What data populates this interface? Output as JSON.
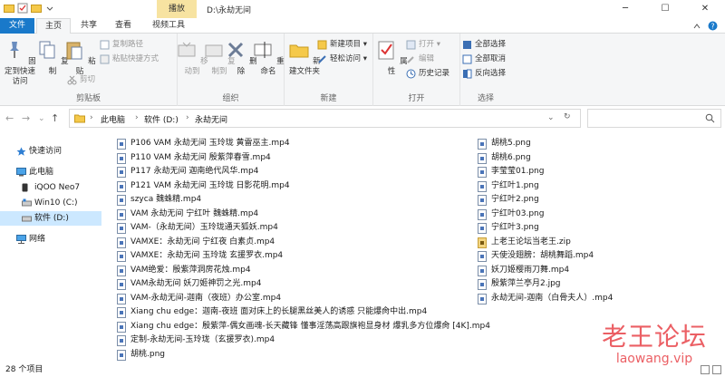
{
  "titlebar": {
    "context_tab": "播放",
    "path": "D:\\永劫无间",
    "minimize": "─",
    "maximize": "☐",
    "close": "✕"
  },
  "tabs": [
    "文件",
    "主页",
    "共享",
    "查看",
    "视频工具"
  ],
  "ribbon": {
    "clipboard": {
      "label": "剪贴板",
      "pin": "固定到快速访问",
      "copy": "复制",
      "paste": "粘贴",
      "cut": "剪切",
      "copy_path": "复制路径",
      "paste_shortcut": "粘贴快捷方式"
    },
    "organize": {
      "label": "组织",
      "move_to": "移动到",
      "copy_to": "复制到",
      "delete": "删除",
      "rename": "重命名"
    },
    "new": {
      "label": "新建",
      "new_folder": "新建文件夹",
      "new_item": "新建项目 ▾",
      "easy_access": "轻松访问 ▾"
    },
    "open": {
      "label": "打开",
      "properties": "属性",
      "open": "打开 ▾",
      "edit": "编辑",
      "history": "历史记录"
    },
    "select": {
      "label": "选择",
      "select_all": "全部选择",
      "select_none": "全部取消",
      "invert": "反向选择"
    }
  },
  "address": {
    "crumbs": [
      "此电脑",
      "软件 (D:)",
      "永劫无间"
    ],
    "search_placeholder": ""
  },
  "nav": [
    {
      "label": "快速访问",
      "icon": "star-icon"
    },
    {
      "label": "此电脑",
      "icon": "computer-icon"
    },
    {
      "label": "iQOO Neo7",
      "icon": "phone-icon"
    },
    {
      "label": "Win10 (C:)",
      "icon": "drive-icon"
    },
    {
      "label": "软件 (D:)",
      "icon": "drive-icon"
    },
    {
      "label": "网络",
      "icon": "network-icon"
    }
  ],
  "files_col1": [
    "P106 VAM 永劫无间 玉玲珑 黄雷巫主.mp4",
    "P110 VAM 永劫无间 殷紫萍春雪.mp4",
    "P117 永劫无间 迦南绝代风华.mp4",
    "P121 VAM 永劫无间 玉玲珑 日影花明.mp4",
    "szyca 魏蛛精.mp4",
    "VAM 永劫无间 宁红叶 魏蛛精.mp4",
    "VAM-（永劫无间）玉玲珑通天狐妖.mp4",
    "VAMXE：永劫无间 宁红夜 白素贞.mp4",
    "VAMXE：永劫无间 玉玲珑 玄援罗衣.mp4",
    "VAM绝爱：殷紫萍洞房花烛.mp4",
    "VAM永劫无间 妖刀姬神罚之光.mp4",
    "VAM-永劫无间-迦南（夜班）办公室.mp4",
    "Xiang chu edge：迦南-夜班 面对床上的长腿黑丝美人的诱惑 只能爆肏中出.mp4",
    "Xiang chu edge：殷紫萍-偶女画魂-长天藏锋 懂事淫荡高跟旗袍显身材 爆乳多方位爆肏 [4K].mp4",
    "定制-永劫无间-玉玲珑（玄援罗衣).mp4",
    "胡桃.png"
  ],
  "files_col2": [
    "胡桃5.png",
    "胡桃6.png",
    "李莹莹01.png",
    "宁红叶1.png",
    "宁红叶2.png",
    "宁红叶03.png",
    "宁红叶3.png",
    "上老王论坛当老王.zip",
    "天使没翅膀：胡桃舞蹈.mp4",
    "妖刀姬樱雨刀舞.mp4",
    "殷紫萍兰亭月2.jpg",
    "永劫无间-迦南（白骨夫人）.mp4"
  ],
  "status": {
    "count": "28 个项目"
  },
  "watermark": {
    "title": "老王论坛",
    "url": "laowang.vip"
  }
}
